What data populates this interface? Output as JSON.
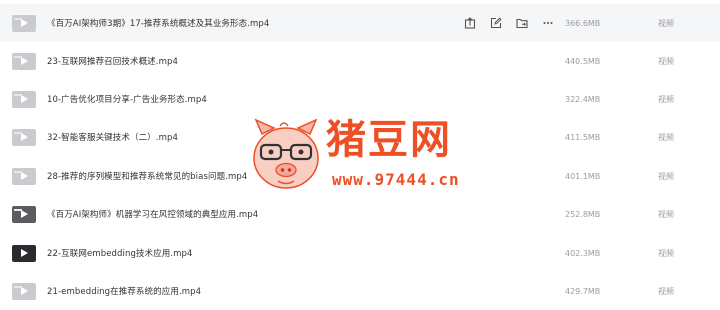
{
  "files": [
    {
      "name": "《百万AI架构师3期》17-推荐系统概述及其业务形态.mp4",
      "size": "366.6MB",
      "type": "视频",
      "thumb": "light",
      "hover": true
    },
    {
      "name": "23-互联网推荐召回技术概述.mp4",
      "size": "440.5MB",
      "type": "视频",
      "thumb": "light",
      "hover": false
    },
    {
      "name": "10-广告优化项目分享-广告业务形态.mp4",
      "size": "322.4MB",
      "type": "视频",
      "thumb": "light",
      "hover": false
    },
    {
      "name": "32-智能客服关键技术（二）.mp4",
      "size": "411.5MB",
      "type": "视频",
      "thumb": "light",
      "hover": false
    },
    {
      "name": "28-推荐的序列模型和推荐系统常见的bias问题.mp4",
      "size": "401.1MB",
      "type": "视频",
      "thumb": "light",
      "hover": false
    },
    {
      "name": "《百万AI架构师》机器学习在风控领域的典型应用.mp4",
      "size": "252.8MB",
      "type": "视频",
      "thumb": "dark",
      "hover": false
    },
    {
      "name": "22-互联网embedding技术应用.mp4",
      "size": "402.3MB",
      "type": "视频",
      "thumb": "darkest",
      "hover": false
    },
    {
      "name": "21-embedding在推荐系统的应用.mp4",
      "size": "429.7MB",
      "type": "视频",
      "thumb": "light",
      "hover": false
    }
  ],
  "row_actions": [
    {
      "icon": "share-icon"
    },
    {
      "icon": "edit-icon"
    },
    {
      "icon": "move-to-folder-icon"
    },
    {
      "icon": "more-icon"
    }
  ],
  "watermark": {
    "title": "猪豆网",
    "url": "www.97444.cn"
  },
  "colors": {
    "name_text": "#333333",
    "meta_text": "#9a9ca0",
    "hover_row": "#f5f6f8",
    "watermark": "#ee4f24"
  }
}
